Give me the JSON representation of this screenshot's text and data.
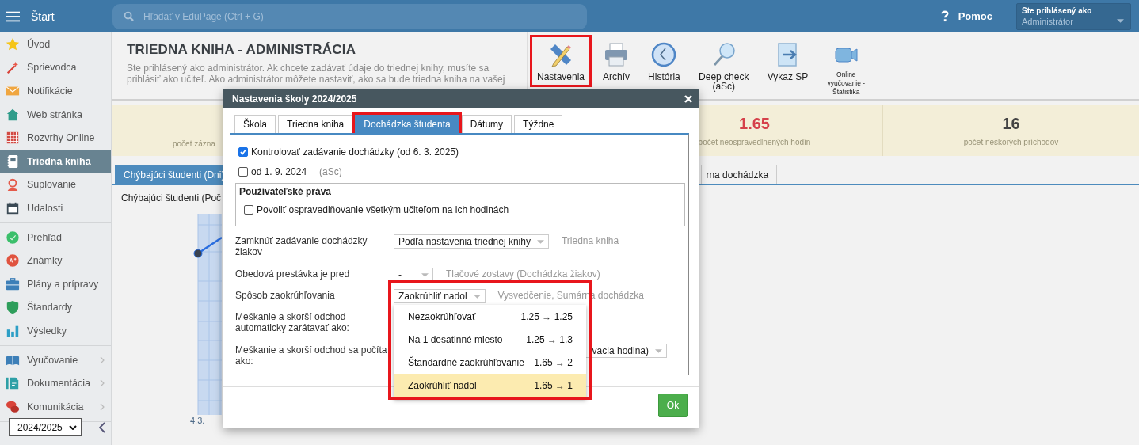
{
  "top_bar": {
    "menu_label": "Štart",
    "search": {
      "placeholder": "Hľadať v EduPage (Ctrl + G)"
    },
    "help_label": "Pomoc",
    "user": {
      "caption": "Ste prihlásený ako",
      "role": "Administrátor"
    }
  },
  "sidebar": {
    "sections": [
      {
        "items": [
          {
            "label": "Úvod",
            "selected": false,
            "has_submenu": false
          },
          {
            "label": "Sprievodca",
            "selected": false,
            "has_submenu": false
          },
          {
            "label": "Notifikácie",
            "selected": false,
            "has_submenu": false
          },
          {
            "label": "Web stránka",
            "selected": false,
            "has_submenu": false
          },
          {
            "label": "Rozvrhy Online",
            "selected": false,
            "has_submenu": false
          },
          {
            "label": "Triedna kniha",
            "selected": true,
            "has_submenu": false
          },
          {
            "label": "Suplovanie",
            "selected": false,
            "has_submenu": false
          },
          {
            "label": "Udalosti",
            "selected": false,
            "has_submenu": false
          }
        ]
      },
      {
        "items": [
          {
            "label": "Prehľad",
            "selected": false,
            "has_submenu": false
          },
          {
            "label": "Známky",
            "selected": false,
            "has_submenu": false
          },
          {
            "label": "Plány a prípravy",
            "selected": false,
            "has_submenu": false
          },
          {
            "label": "Štandardy",
            "selected": false,
            "has_submenu": false
          },
          {
            "label": "Výsledky",
            "selected": false,
            "has_submenu": false
          }
        ]
      },
      {
        "items": [
          {
            "label": "Vyučovanie",
            "selected": false,
            "has_submenu": true
          },
          {
            "label": "Dokumentácia",
            "selected": false,
            "has_submenu": true
          },
          {
            "label": "Komunikácia",
            "selected": false,
            "has_submenu": true
          }
        ]
      }
    ],
    "year_select": {
      "value": "2024/2025"
    }
  },
  "page": {
    "title": "TRIEDNA KNIHA - ADMINISTRÁCIA",
    "intro": "Ste prihlásený ako administrátor. Ak chcete zadávať údaje do triednej knihy, musíte sa prihlásiť ako učiteľ. Ako administrátor môžete nastaviť, ako sa bude triedna kniha na vašej",
    "toolbar": [
      {
        "label": "Nastavenia",
        "highlighted": true,
        "compact": false
      },
      {
        "label": "Archív",
        "highlighted": false,
        "compact": false
      },
      {
        "label": "História",
        "highlighted": false,
        "compact": false
      },
      {
        "label": "Deep check (aSc)",
        "highlighted": false,
        "compact": false
      },
      {
        "label": "Vykaz SP",
        "highlighted": false,
        "compact": false
      },
      {
        "label": "Online vyučovanie - Štatistika",
        "highlighted": false,
        "compact": true
      }
    ],
    "stats": [
      {
        "label": "počet zázna"
      },
      {
        "value": "1.65",
        "label": "počet neospravedlnených hodín",
        "alert": true
      },
      {
        "value": "16",
        "label": "počet neskorých príchodov",
        "alert": false
      }
    ],
    "tabs": [
      {
        "label": "Chýbajúci študenti (Dni)",
        "selected": true
      },
      {
        "label": "rna dochádzka",
        "selected": false
      }
    ],
    "chart": {
      "title": "Chýbajúci študenti (Poč",
      "x_label": "4.3."
    }
  },
  "modal": {
    "title": "Nastavenia školy 2024/2025",
    "tabs": [
      {
        "label": "Škola",
        "selected": false,
        "highlighted": false
      },
      {
        "label": "Triedna kniha",
        "selected": false,
        "highlighted": false
      },
      {
        "label": "Dochádzka študenta",
        "selected": true,
        "highlighted": true
      },
      {
        "label": "Dátumy",
        "selected": false,
        "highlighted": false
      },
      {
        "label": "Týždne",
        "selected": false,
        "highlighted": false
      }
    ],
    "checks": [
      {
        "label": "Kontrolovať zadávanie dochádzky (od 6. 3. 2025)",
        "checked": true
      },
      {
        "label": "od 1. 9. 2024",
        "note": "(aSc)",
        "checked": false
      }
    ],
    "rights": {
      "title": "Používateľské práva",
      "checks": [
        {
          "label": "Povoliť ospravedlňovanie všetkým učiteľom na ich hodinách",
          "checked": false
        }
      ]
    },
    "settings": [
      {
        "label": "Zamknúť zadávanie dochádzky žiakov",
        "value": "Podľa nastavenia triednej knihy",
        "note": "Triedna kniha"
      },
      {
        "label": "Obedová prestávka je pred",
        "value": "-",
        "note": "Tlačové zostavy (Dochádzka žiakov)"
      },
      {
        "label": "Spôsob zaokrúhľovania",
        "value": "Zaokrúhliť nadol",
        "note": "Vysvedčenie, Sumárna dochádzka",
        "highlighted": true,
        "options": [
          {
            "label": "Nezaokrúhľovať",
            "example": "1.25 → 1.25",
            "selected": false
          },
          {
            "label": "Na 1 desatinné miesto",
            "example": "1.25 → 1.3",
            "selected": false
          },
          {
            "label": "Štandardné zaokrúhľovanie",
            "example": "1.65 → 2",
            "selected": false
          },
          {
            "label": "Zaokrúhliť nadol",
            "example": "1.65 → 1",
            "selected": true
          }
        ]
      },
      {
        "label": "Meškanie a skorší odchod automaticky zarátavať ako:"
      },
      {
        "label": "Meškanie a skorší odchod sa počíta ako:",
        "value": "vacia hodina)"
      }
    ],
    "ok_label": "Ok"
  }
}
